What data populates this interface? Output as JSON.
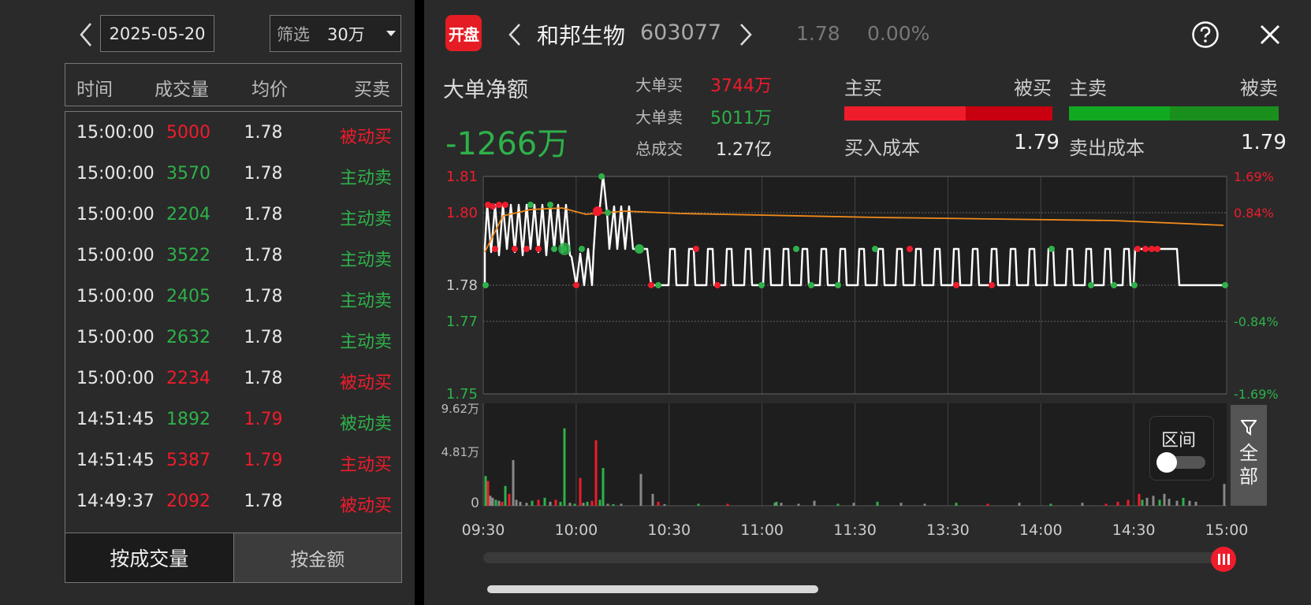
{
  "left": {
    "date": "2025-05-20",
    "filter_label": "筛选",
    "filter_value": "30万",
    "headers": {
      "time": "时间",
      "volume": "成交量",
      "price": "均价",
      "side": "买卖"
    },
    "trades": [
      {
        "time": "15:00:00",
        "volume": "5000",
        "vol_color": "red",
        "price": "1.78",
        "price_color": "white",
        "side": "被动买",
        "side_color": "red"
      },
      {
        "time": "15:00:00",
        "volume": "3570",
        "vol_color": "green",
        "price": "1.78",
        "price_color": "white",
        "side": "主动卖",
        "side_color": "green"
      },
      {
        "time": "15:00:00",
        "volume": "2204",
        "vol_color": "green",
        "price": "1.78",
        "price_color": "white",
        "side": "主动卖",
        "side_color": "green"
      },
      {
        "time": "15:00:00",
        "volume": "3522",
        "vol_color": "green",
        "price": "1.78",
        "price_color": "white",
        "side": "主动卖",
        "side_color": "green"
      },
      {
        "time": "15:00:00",
        "volume": "2405",
        "vol_color": "green",
        "price": "1.78",
        "price_color": "white",
        "side": "主动卖",
        "side_color": "green"
      },
      {
        "time": "15:00:00",
        "volume": "2632",
        "vol_color": "green",
        "price": "1.78",
        "price_color": "white",
        "side": "主动卖",
        "side_color": "green"
      },
      {
        "time": "15:00:00",
        "volume": "2234",
        "vol_color": "red",
        "price": "1.78",
        "price_color": "white",
        "side": "被动买",
        "side_color": "red"
      },
      {
        "time": "14:51:45",
        "volume": "1892",
        "vol_color": "green",
        "price": "1.79",
        "price_color": "red",
        "side": "被动卖",
        "side_color": "green"
      },
      {
        "time": "14:51:45",
        "volume": "5387",
        "vol_color": "red",
        "price": "1.79",
        "price_color": "red",
        "side": "主动买",
        "side_color": "red"
      },
      {
        "time": "14:49:37",
        "volume": "2092",
        "vol_color": "red",
        "price": "1.78",
        "price_color": "white",
        "side": "被动买",
        "side_color": "red"
      }
    ],
    "tab_volume": "按成交量",
    "tab_amount": "按金额"
  },
  "header": {
    "logo": "开盘",
    "name": "和邦生物",
    "code": "603077",
    "price": "1.78",
    "change": "0.00%"
  },
  "summary": {
    "net_label": "大单净额",
    "net_value": "-1266万",
    "big_buy_label": "大单买",
    "big_buy_value": "3744万",
    "big_sell_label": "大单卖",
    "big_sell_value": "5011万",
    "total_label": "总成交",
    "total_value": "1.27亿",
    "active_buy": "主买",
    "passive_buy": "被买",
    "active_sell": "主卖",
    "passive_sell": "被卖",
    "buy_cost_label": "买入成本",
    "buy_cost_value": "1.79",
    "sell_cost_label": "卖出成本",
    "sell_cost_value": "1.79"
  },
  "controls": {
    "range_label": "区间",
    "range_on": false,
    "all_label": "全部"
  },
  "colors": {
    "red": "#ef1c2b",
    "green": "#2eb14a",
    "avg_line": "#f08a1c"
  },
  "chart_data": {
    "type": "line",
    "price_ticks": [
      "1.81",
      "1.80",
      "1.78",
      "1.77",
      "1.75"
    ],
    "pct_ticks": [
      "1.69%",
      "0.84%",
      "",
      "-0.84%",
      "-1.69%"
    ],
    "ylim": [
      1.75,
      1.81
    ],
    "base_price": 1.78,
    "x_ticks": [
      "09:30",
      "10:00",
      "10:30",
      "11:00",
      "11:30",
      "13:30",
      "14:00",
      "14:30",
      "15:00"
    ],
    "volume_ticks": [
      "9.62万",
      "4.81万",
      "0"
    ],
    "volume_max": 9.62
  }
}
